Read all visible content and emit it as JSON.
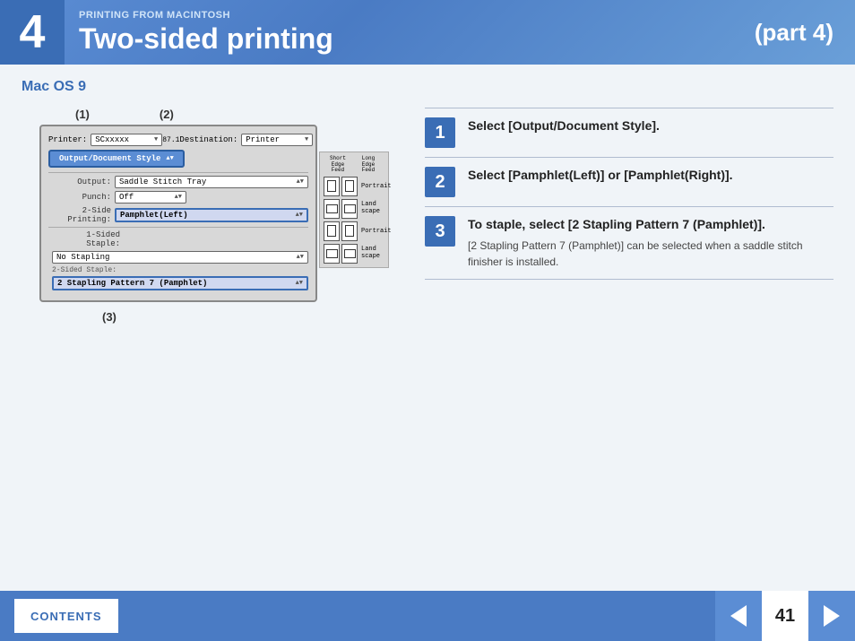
{
  "header": {
    "chapter_number": "4",
    "subtitle": "PRINTING FROM MACINTOSH",
    "title": "Two-sided printing",
    "part": "(part 4)"
  },
  "section": {
    "title": "Mac OS 9"
  },
  "annotations": {
    "label1": "(1)",
    "label2": "(2)",
    "label3": "(3)"
  },
  "dialog": {
    "printer_label": "Printer:",
    "printer_value": "SCxxxxx",
    "destination_label": "Destination:",
    "destination_value": "Printer",
    "output_document_style_btn": "Output/Document Style",
    "output_label": "Output:",
    "output_value": "Saddle Stitch Tray",
    "punch_label": "Punch:",
    "punch_value": "Off",
    "two_side_label": "2-Side Printing:",
    "two_side_value": "Pamphlet(Left)",
    "one_side_staple_label": "1-Sided Staple:",
    "one_side_staple_value": "No Stapling",
    "two_side_staple_label": "2 Stapling Pattern 7 (Pamphlet)",
    "short_edge_feed": "Short Edge Feed",
    "long_edge_feed": "Long Edge Feed",
    "portrait": "Portrait",
    "landscape": "Land scape",
    "page_number": "87.1"
  },
  "steps": [
    {
      "number": "1",
      "main_text": "Select [Output/Document Style].",
      "sub_text": ""
    },
    {
      "number": "2",
      "main_text": "Select [Pamphlet(Left)] or [Pamphlet(Right)].",
      "sub_text": ""
    },
    {
      "number": "3",
      "main_text": "To staple, select [2 Stapling Pattern 7 (Pamphlet)].",
      "sub_text": "[2 Stapling Pattern 7 (Pamphlet)] can be selected when a saddle stitch finisher is installed."
    }
  ],
  "footer": {
    "contents_label": "CONTENTS",
    "page_number": "41"
  }
}
